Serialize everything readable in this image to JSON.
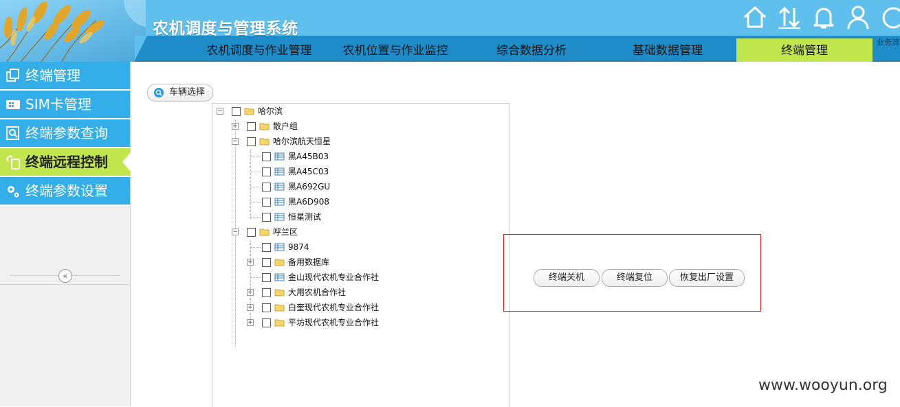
{
  "app": {
    "title": "农机调度与管理系统"
  },
  "top_icons": [
    {
      "name": "home-icon"
    },
    {
      "name": "upload-download-icon"
    },
    {
      "name": "bell-icon"
    },
    {
      "name": "user-icon"
    },
    {
      "name": "refresh-icon"
    }
  ],
  "top_label": "业务流",
  "nav": {
    "items": [
      {
        "label": "农机调度与作业管理",
        "active": false
      },
      {
        "label": "农机位置与作业监控",
        "active": false
      },
      {
        "label": "综合数据分析",
        "active": false
      },
      {
        "label": "基础数据管理",
        "active": false
      },
      {
        "label": "终端管理",
        "active": true
      }
    ]
  },
  "sidebar": {
    "items": [
      {
        "label": "终端管理",
        "icon": "windows-icon",
        "active": false
      },
      {
        "label": "SIM卡管理",
        "icon": "sim-card-icon",
        "active": false
      },
      {
        "label": "终端参数查询",
        "icon": "search-doc-icon",
        "active": false
      },
      {
        "label": "终端远程控制",
        "icon": "remote-control-icon",
        "active": true
      },
      {
        "label": "终端参数设置",
        "icon": "gears-icon",
        "active": false
      }
    ],
    "collapse": "«"
  },
  "vehicle_select": {
    "label": "车辆选择"
  },
  "tree": {
    "nodes": [
      {
        "label": "哈尔滨",
        "type": "folder",
        "expanded": true
      },
      {
        "label": "散户组",
        "type": "folder",
        "expanded": false
      },
      {
        "label": "哈尔滨航天恒星",
        "type": "folder",
        "expanded": true
      },
      {
        "label": "黑A45B03",
        "type": "item"
      },
      {
        "label": "黑A45C03",
        "type": "item"
      },
      {
        "label": "黑A692GU",
        "type": "item"
      },
      {
        "label": "黑A6D908",
        "type": "item"
      },
      {
        "label": "恒星测试",
        "type": "item"
      },
      {
        "label": "呼兰区",
        "type": "folder",
        "expanded": true
      },
      {
        "label": "9874",
        "type": "item"
      },
      {
        "label": "备用数据库",
        "type": "folder",
        "expanded": false
      },
      {
        "label": "金山现代农机专业合作社",
        "type": "item"
      },
      {
        "label": "大用农机合作社",
        "type": "folder",
        "expanded": false
      },
      {
        "label": "白奎现代农机专业合作社",
        "type": "folder",
        "expanded": false
      },
      {
        "label": "平坊现代农机专业合作社",
        "type": "folder",
        "expanded": false
      }
    ]
  },
  "controls": {
    "shutdown": "终端关机",
    "reset": "终端复位",
    "factory_reset": "恢复出厂设置"
  },
  "watermark": "www.wooyun.org",
  "colors": {
    "header": "#5fc0ee",
    "nav": "#1e8cc8",
    "active": "#c2e64e",
    "sidebar_item": "#33aee8",
    "red_border": "#dd2222"
  }
}
